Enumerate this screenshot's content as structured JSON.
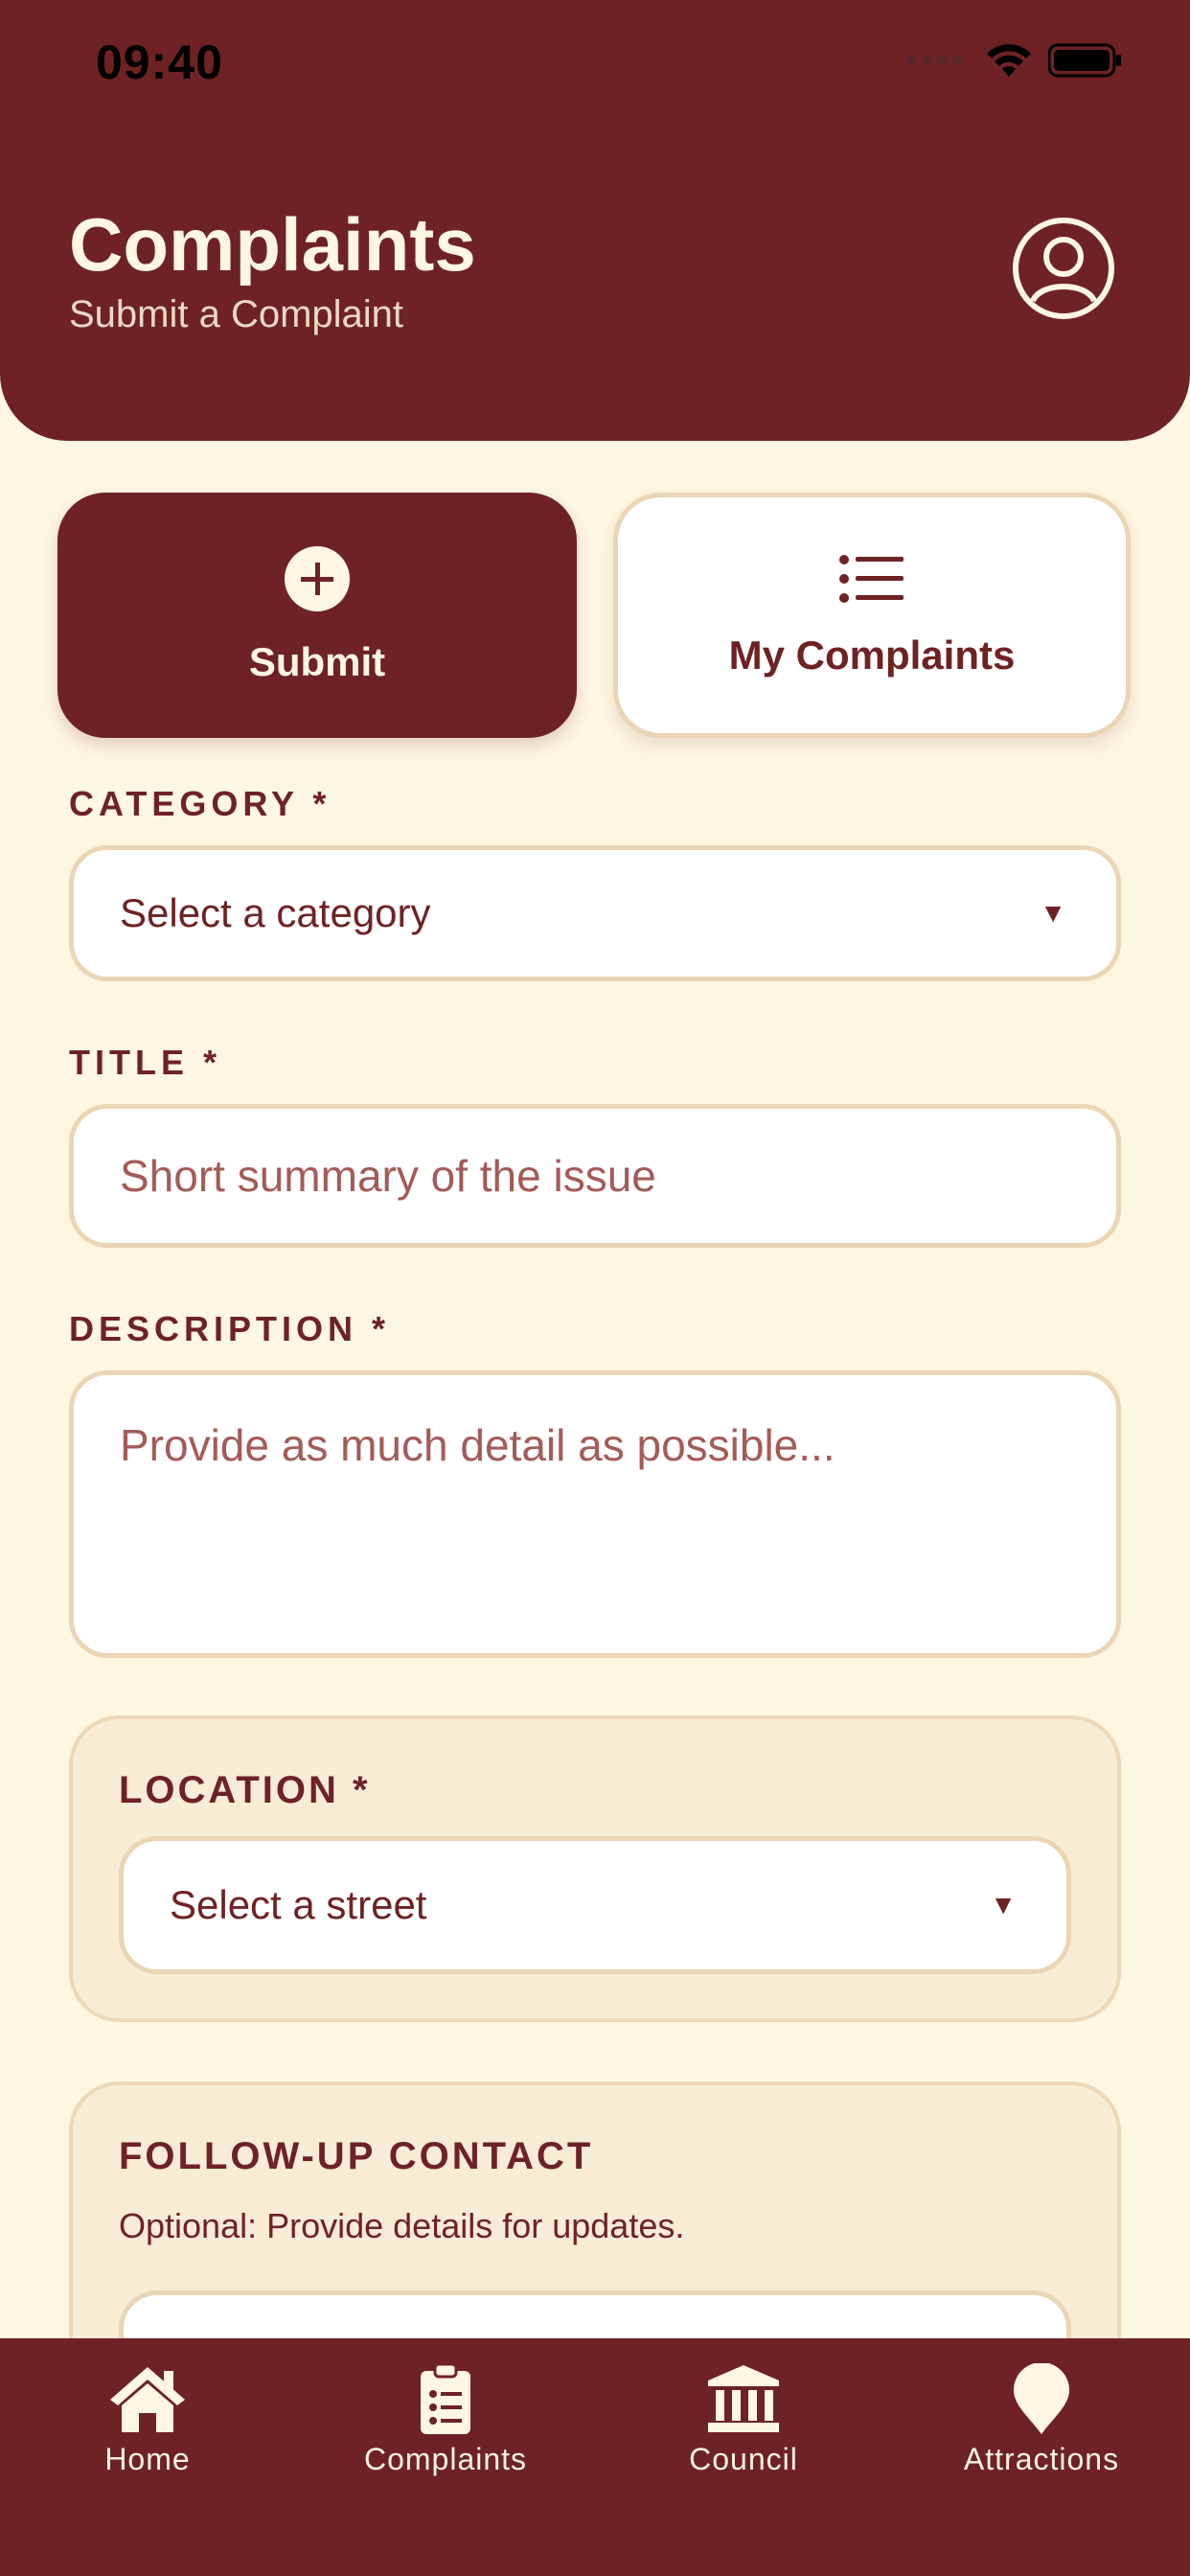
{
  "status_bar": {
    "time": "09:40"
  },
  "header": {
    "title": "Complaints",
    "subtitle": "Submit a Complaint"
  },
  "segments": {
    "submit_label": "Submit",
    "my_complaints_label": "My Complaints"
  },
  "form": {
    "category": {
      "label": "CATEGORY *",
      "value": "Select a category"
    },
    "title": {
      "label": "TITLE *",
      "placeholder": "Short summary of the issue"
    },
    "description": {
      "label": "DESCRIPTION *",
      "placeholder": "Provide as much detail as possible..."
    },
    "location": {
      "label": "LOCATION *",
      "value": "Select a street"
    },
    "follow_up": {
      "label": "FOLLOW-UP CONTACT",
      "hint": "Optional: Provide details for updates."
    }
  },
  "bottom_nav": {
    "items": [
      {
        "label": "Home",
        "icon": "home-icon"
      },
      {
        "label": "Complaints",
        "icon": "clipboard-list-icon"
      },
      {
        "label": "Council",
        "icon": "landmark-icon"
      },
      {
        "label": "Attractions",
        "icon": "map-pin-icon"
      }
    ]
  },
  "colors": {
    "primary": "#6e2224",
    "background": "#fdf6e1",
    "panel": "#f8ecd4",
    "border": "#ead5b4"
  },
  "icons": [
    "wifi-icon",
    "battery-icon",
    "user-circle-icon",
    "plus-circle-icon",
    "list-icon",
    "dropdown-caret-icon"
  ]
}
